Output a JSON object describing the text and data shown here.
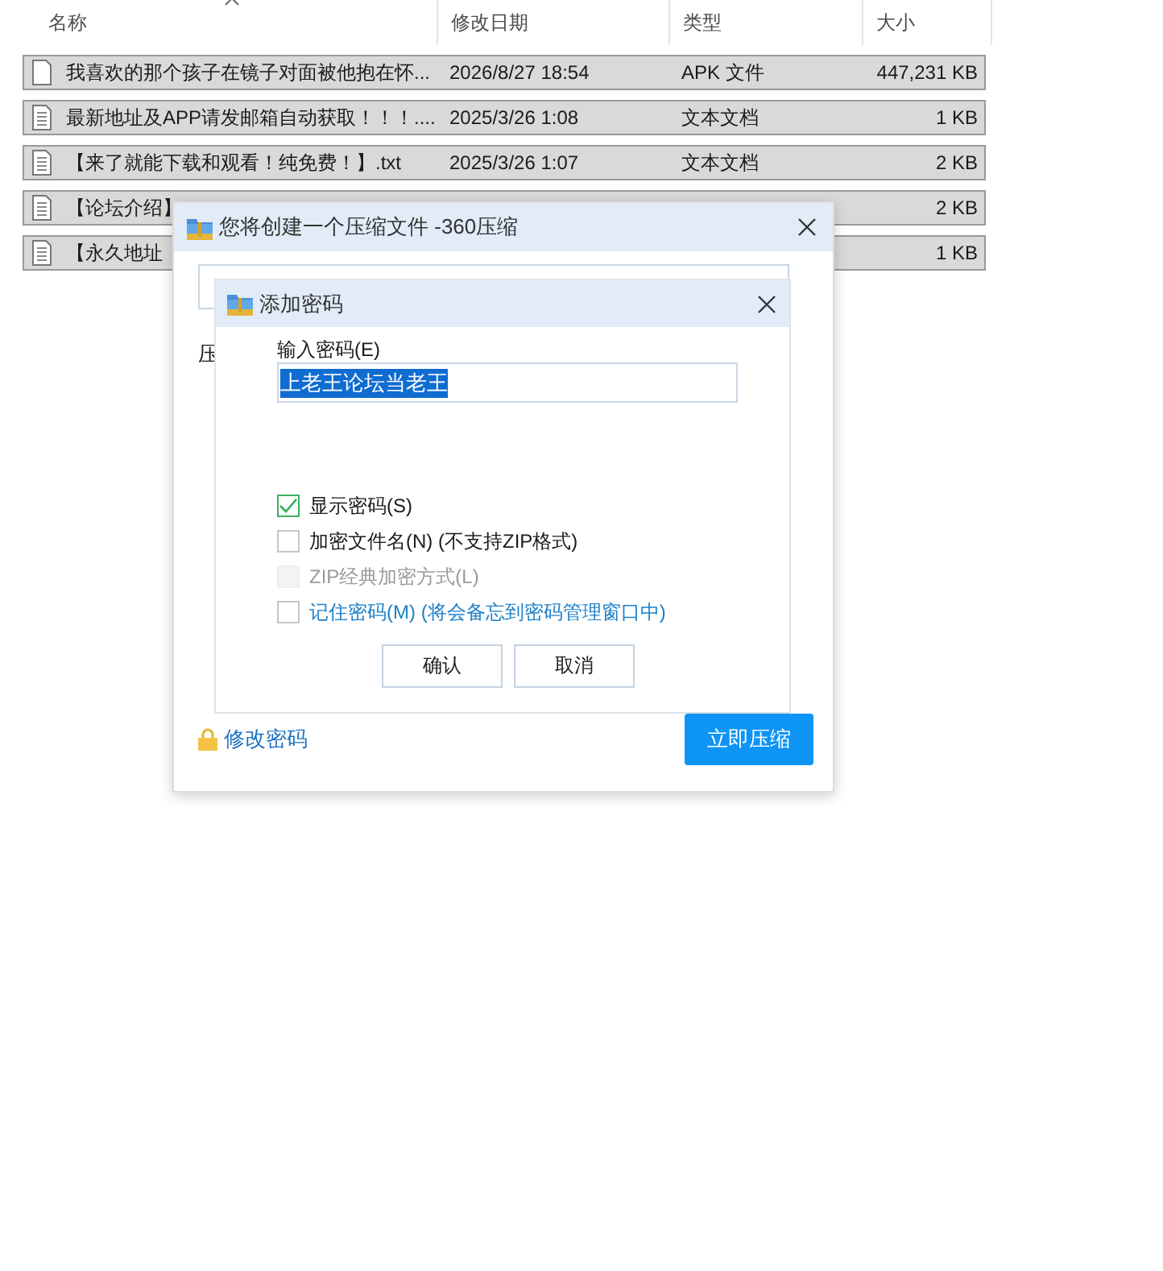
{
  "explorer": {
    "columns": [
      {
        "label": "名称",
        "sorted": true
      },
      {
        "label": "修改日期",
        "sorted": false
      },
      {
        "label": "类型",
        "sorted": false
      },
      {
        "label": "大小",
        "sorted": false
      }
    ],
    "rows": [
      {
        "kind": "blank",
        "name": "我喜欢的那个孩子在镜子对面被他抱在怀...",
        "date": "2026/8/27 18:54",
        "type": "APK 文件",
        "size": "447,231 KB",
        "selected": true
      },
      {
        "kind": "text",
        "name": "最新地址及APP请发邮箱自动获取！！！....",
        "date": "2025/3/26 1:08",
        "type": "文本文档",
        "size": "1 KB",
        "selected": true
      },
      {
        "kind": "text",
        "name": "【来了就能下载和观看！纯免费！】.txt",
        "date": "2025/3/26 1:07",
        "type": "文本文档",
        "size": "2 KB",
        "selected": true
      },
      {
        "kind": "text",
        "name": "【论坛介绍】",
        "size": "2 KB",
        "selected": true
      },
      {
        "kind": "text",
        "name": "【永久地址",
        "size": "1 KB",
        "selected": true
      }
    ]
  },
  "compress_dialog": {
    "title": "您将创建一个压缩文件 -360压缩",
    "label": "压",
    "change_password_link": "修改密码",
    "compress_button": "立即压缩"
  },
  "password_dialog": {
    "title": "添加密码",
    "field_label": "输入密码(E)",
    "password": {
      "value": "上老王论坛当老王",
      "highlighted": true
    },
    "options": [
      {
        "kind": "plain",
        "label": "显示密码(S)",
        "checked": true,
        "disabled": false
      },
      {
        "kind": "plain",
        "label": "加密文件名(N) (不支持ZIP格式)",
        "checked": false,
        "disabled": false
      },
      {
        "kind": "plain",
        "label": "ZIP经典加密方式(L)",
        "checked": false,
        "disabled": true
      },
      {
        "kind": "link",
        "label": "记住密码(M) (将会备忘到密码管理窗口中)",
        "checked": false,
        "disabled": false
      }
    ],
    "buttons": [
      "确认",
      "取消"
    ]
  }
}
